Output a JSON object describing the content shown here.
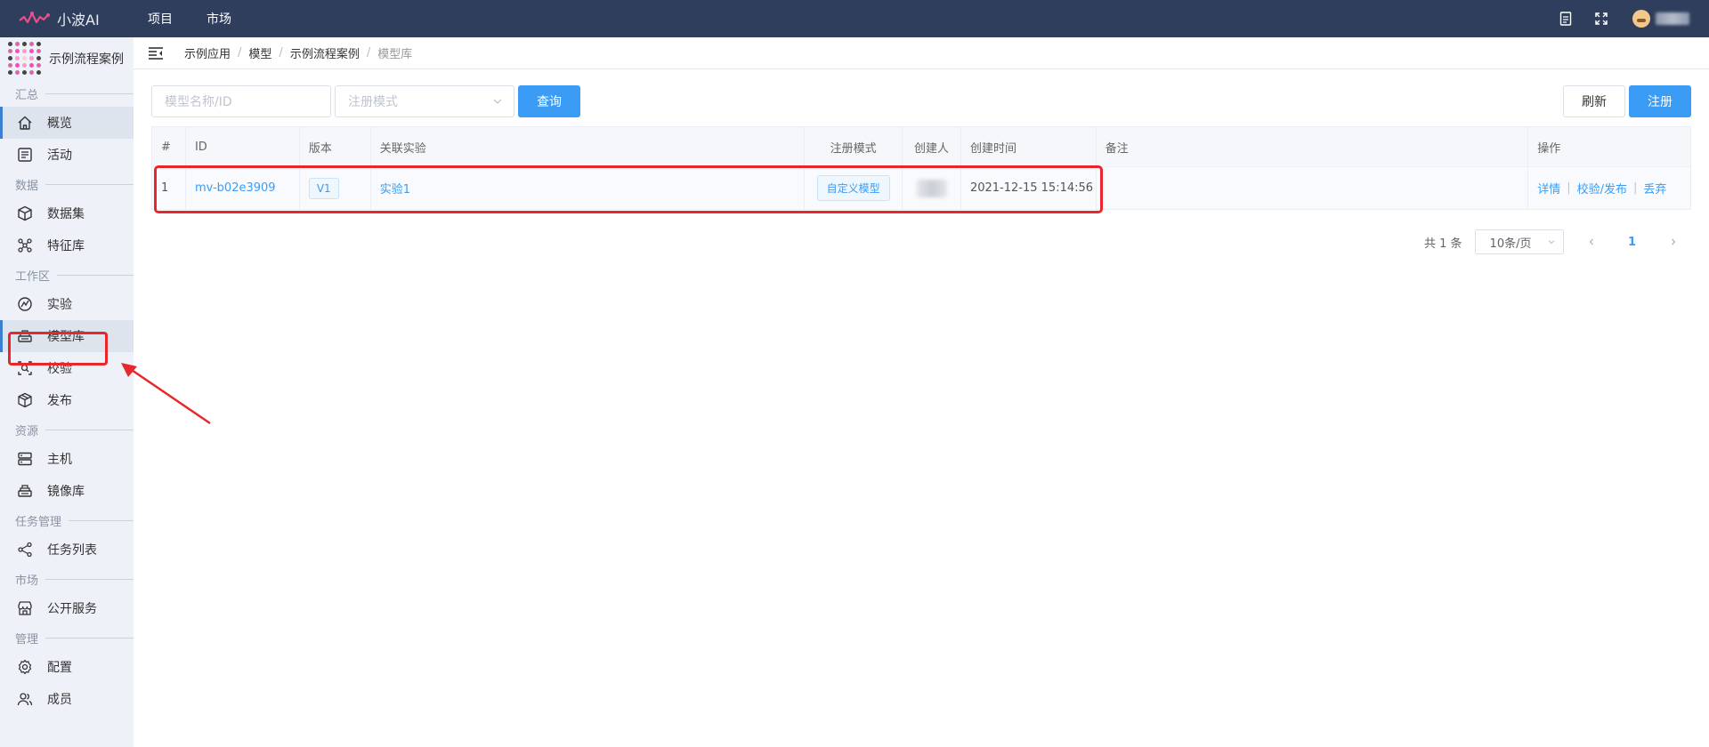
{
  "brand": {
    "name": "小波AI"
  },
  "topnav": [
    {
      "label": "项目"
    },
    {
      "label": "市场"
    }
  ],
  "app": {
    "name": "示例流程案例"
  },
  "sidebar": {
    "sections": [
      {
        "title": "汇总",
        "items": [
          {
            "label": "概览",
            "icon": "home-icon"
          },
          {
            "label": "活动",
            "icon": "activity-icon"
          }
        ]
      },
      {
        "title": "数据",
        "items": [
          {
            "label": "数据集",
            "icon": "cube-icon"
          },
          {
            "label": "特征库",
            "icon": "network-icon"
          }
        ]
      },
      {
        "title": "工作区",
        "items": [
          {
            "label": "实验",
            "icon": "experiment-icon"
          },
          {
            "label": "模型库",
            "icon": "model-library-icon"
          },
          {
            "label": "校验",
            "icon": "validate-icon"
          },
          {
            "label": "发布",
            "icon": "package-icon"
          }
        ]
      },
      {
        "title": "资源",
        "items": [
          {
            "label": "主机",
            "icon": "server-icon"
          },
          {
            "label": "镜像库",
            "icon": "image-library-icon"
          }
        ]
      },
      {
        "title": "任务管理",
        "items": [
          {
            "label": "任务列表",
            "icon": "share-icon"
          }
        ]
      },
      {
        "title": "市场",
        "items": [
          {
            "label": "公开服务",
            "icon": "store-icon"
          }
        ]
      },
      {
        "title": "管理",
        "items": [
          {
            "label": "配置",
            "icon": "gear-icon"
          },
          {
            "label": "成员",
            "icon": "members-icon"
          }
        ]
      }
    ]
  },
  "breadcrumb": [
    "示例应用",
    "模型",
    "示例流程案例",
    "模型库"
  ],
  "toolbar": {
    "name_placeholder": "模型名称/ID",
    "mode_placeholder": "注册模式",
    "query_label": "查询",
    "refresh_label": "刷新",
    "register_label": "注册"
  },
  "table": {
    "columns": [
      "#",
      "ID",
      "版本",
      "关联实验",
      "注册模式",
      "创建人",
      "创建时间",
      "备注",
      "操作"
    ],
    "rows": [
      {
        "index": "1",
        "id": "mv-b02e3909",
        "version": "V1",
        "experiment": "实验1",
        "mode": "自定义模型",
        "created_at": "2021-12-15 15:14:56",
        "note": "",
        "ops": [
          "详情",
          "校验/发布",
          "丢弃"
        ]
      }
    ]
  },
  "pagination": {
    "total": "共 1 条",
    "page_size": "10条/页",
    "current": "1"
  },
  "colors": {
    "topbar": "#2f3e5c",
    "accent": "#3b9cf5",
    "highlight": "#e8272d",
    "sidebar": "#eef2f8"
  }
}
